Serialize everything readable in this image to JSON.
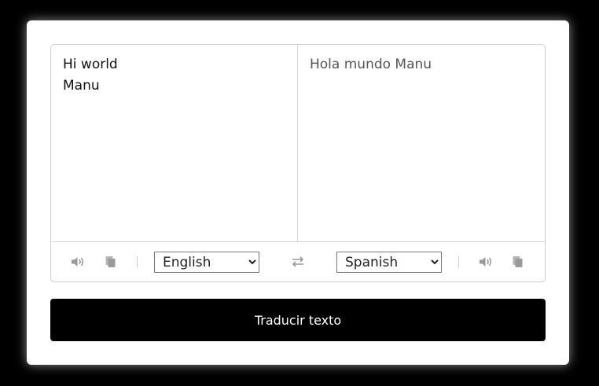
{
  "translator": {
    "from_text": "Hi world\nManu",
    "to_text": "Hola mundo Manu",
    "from_language": "English",
    "to_language": "Spanish",
    "button_label": "Traducir texto"
  },
  "icons": {
    "speak": "volume-icon",
    "copy": "copy-icon",
    "swap": "exchange-icon"
  },
  "colors": {
    "background": "#000000",
    "card": "#ffffff",
    "button": "#000000",
    "button_text": "#ffffff",
    "icon": "#9a9a9a"
  }
}
